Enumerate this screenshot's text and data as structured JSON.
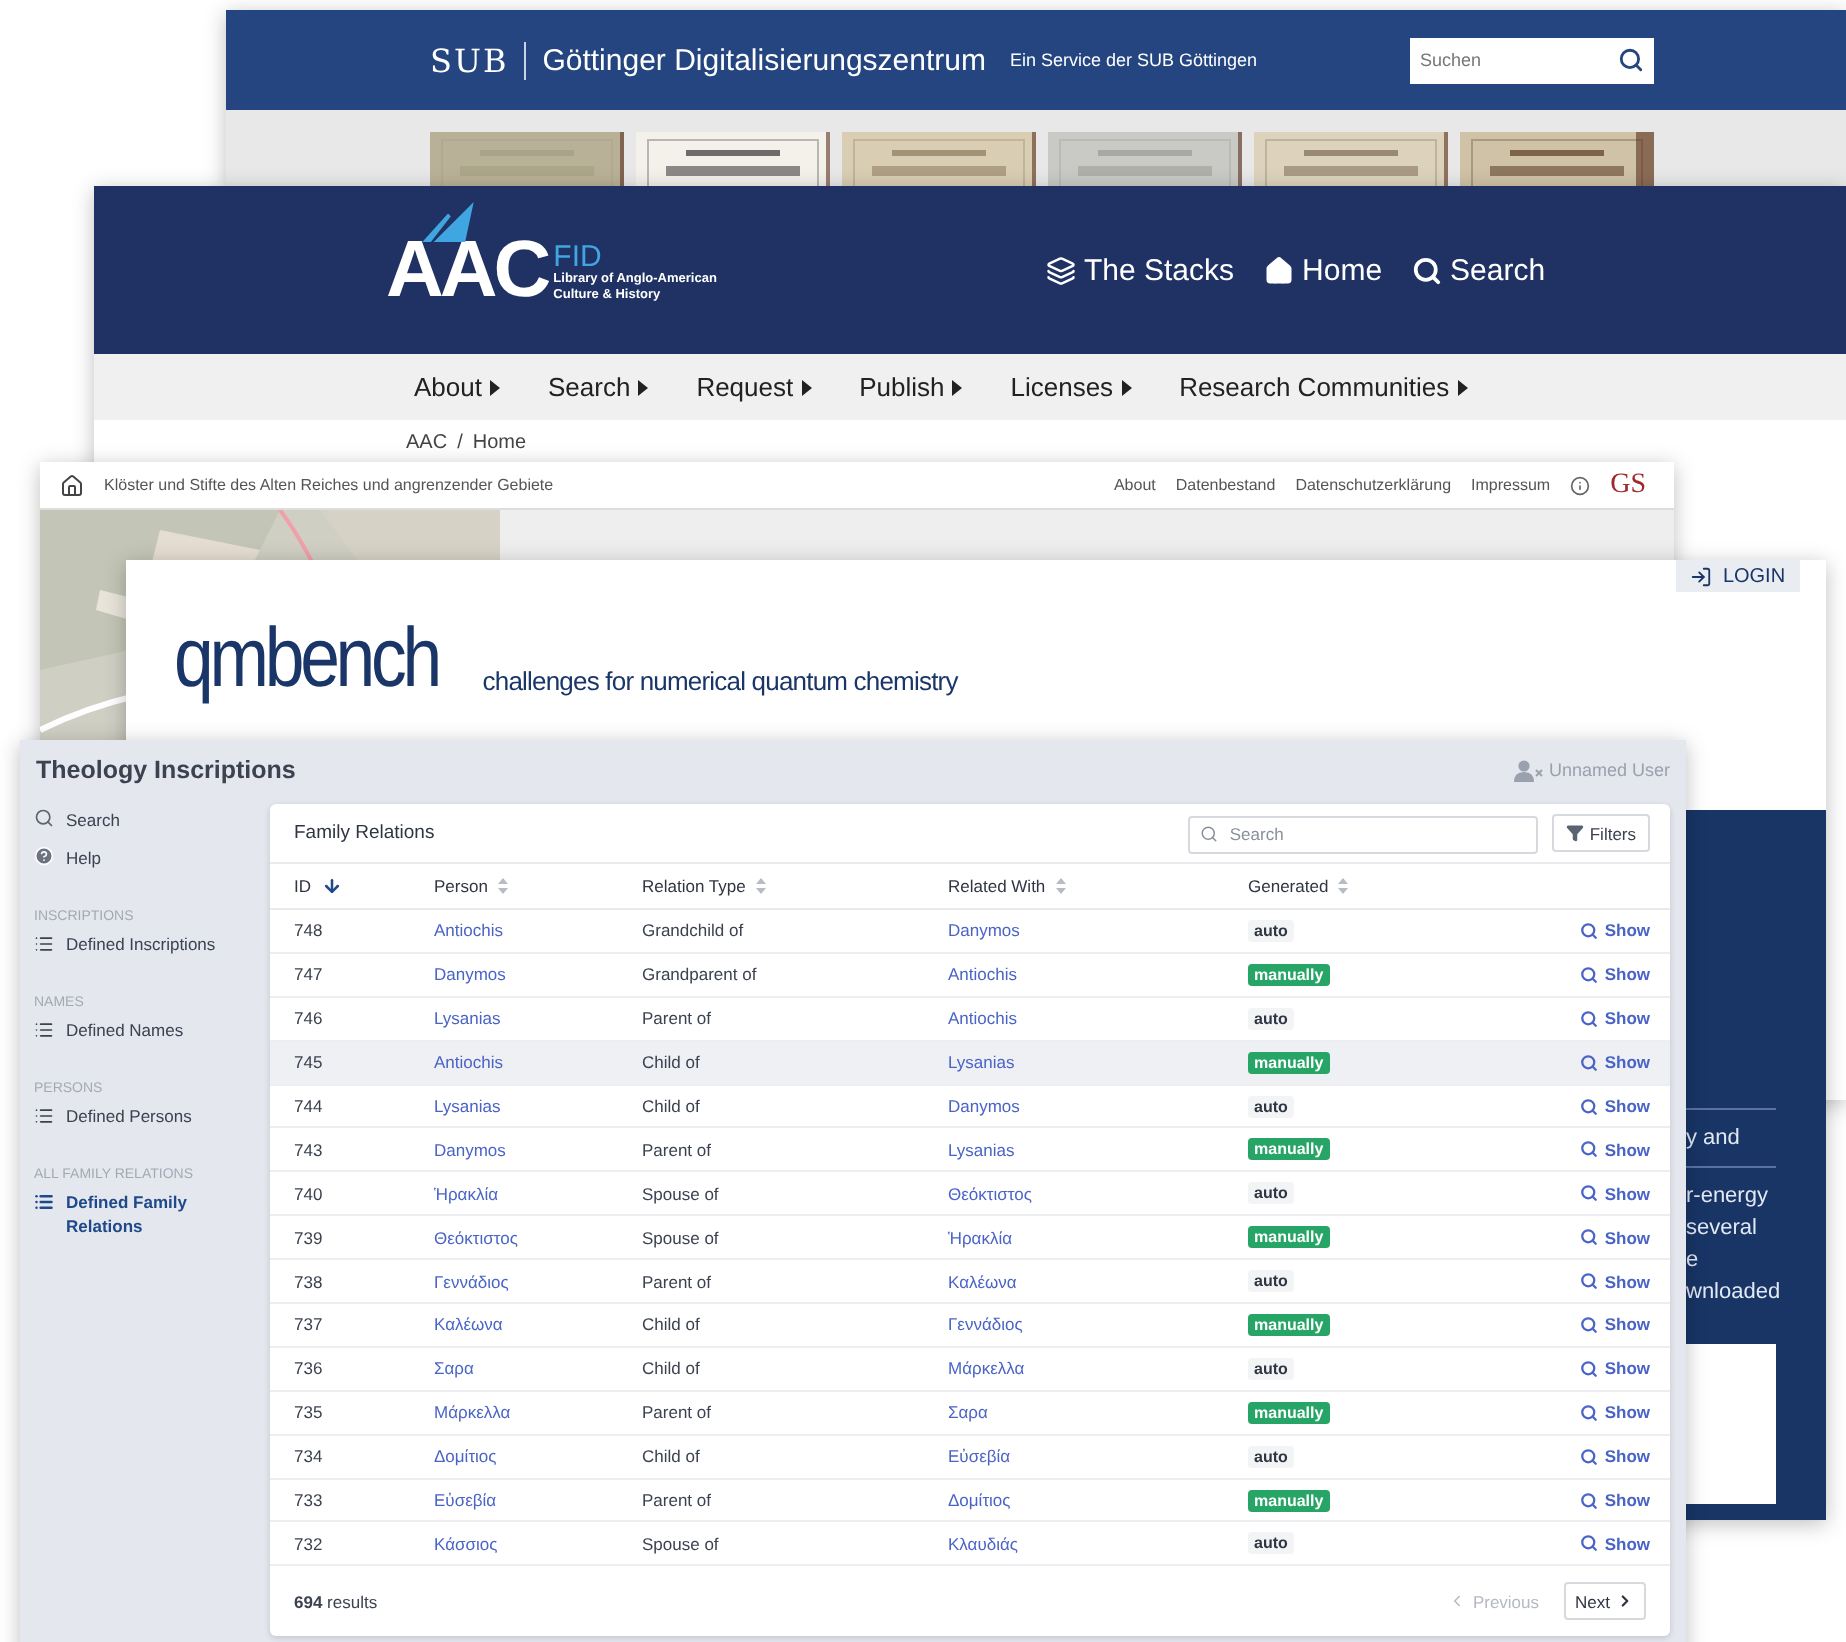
{
  "sub_window": {
    "logo": "SUB",
    "title": "Göttinger Digitalisierungszentrum",
    "subtitle": "Ein Service der SUB Göttingen",
    "search": {
      "placeholder": "Suchen"
    },
    "thumbnails": [
      {
        "kind": "picture"
      },
      {
        "kind": "picture"
      },
      {
        "kind": "picture"
      },
      {
        "kind": "picture"
      },
      {
        "kind": "picture"
      },
      {
        "kind": "picture"
      }
    ]
  },
  "aac_window": {
    "logo": {
      "mark": "AAC",
      "suffix": "FID",
      "tagline": [
        "Library of Anglo-American",
        "Culture & History"
      ]
    },
    "header_links": [
      {
        "label": "The Stacks",
        "kind": "stacks"
      },
      {
        "label": "Home",
        "kind": "home"
      },
      {
        "label": "Search",
        "kind": "search"
      }
    ],
    "nav": [
      "About",
      "Search",
      "Request",
      "Publish",
      "Licenses",
      "Research Communities"
    ],
    "breadcrumb": {
      "items": [
        "AAC",
        "Home"
      ],
      "separator": "/"
    }
  },
  "gs_window": {
    "title": "Klöster und Stifte des Alten Reiches und angrenzender Gebiete",
    "links": [
      "About",
      "Datenbestand",
      "Datenschutzerklärung",
      "Impressum"
    ],
    "logo": "GS",
    "map": {
      "kind": "picture"
    }
  },
  "qmbench_window": {
    "login": "LOGIN",
    "title": "qmbench",
    "tagline": "challenges for numerical quantum chemistry",
    "panel_blocks": [
      [
        "y and"
      ],
      [
        "r-energy",
        "several",
        "e",
        "wnloaded"
      ]
    ]
  },
  "inscriptions_window": {
    "title": "Theology Inscriptions",
    "user": "Unnamed User",
    "sidebar": {
      "top_items": [
        {
          "label": "Search",
          "kind": "search",
          "selected": false
        },
        {
          "label": "Help",
          "kind": "help",
          "selected": false
        }
      ],
      "sections": [
        {
          "heading": "INSCRIPTIONS",
          "items": [
            {
              "label": "Defined Inscriptions",
              "selected": false
            }
          ]
        },
        {
          "heading": "NAMES",
          "items": [
            {
              "label": "Defined Names",
              "selected": false
            }
          ]
        },
        {
          "heading": "PERSONS",
          "items": [
            {
              "label": "Defined Persons",
              "selected": false
            }
          ]
        },
        {
          "heading": "ALL FAMILY RELATIONS",
          "items": [
            {
              "label": "Defined Family Relations",
              "selected": true
            }
          ]
        }
      ]
    },
    "table": {
      "title": "Family Relations",
      "search": {
        "placeholder": "Search"
      },
      "filters_button": "Filters",
      "columns": [
        {
          "label": "ID",
          "sorted": true
        },
        {
          "label": "Person",
          "sorted": false
        },
        {
          "label": "Relation Type",
          "sorted": false
        },
        {
          "label": "Related With",
          "sorted": false
        },
        {
          "label": "Generated",
          "sorted": false
        }
      ],
      "rows": [
        {
          "id": "748",
          "person": "Antiochis",
          "relation": "Grandchild of",
          "related": "Danymos",
          "generated": "auto",
          "manual": false,
          "action": "Show",
          "highlighted": false
        },
        {
          "id": "747",
          "person": "Danymos",
          "relation": "Grandparent of",
          "related": "Antiochis",
          "generated": "manually",
          "manual": true,
          "action": "Show",
          "highlighted": false
        },
        {
          "id": "746",
          "person": "Lysanias",
          "relation": "Parent of",
          "related": "Antiochis",
          "generated": "auto",
          "manual": false,
          "action": "Show",
          "highlighted": false
        },
        {
          "id": "745",
          "person": "Antiochis",
          "relation": "Child of",
          "related": "Lysanias",
          "generated": "manually",
          "manual": true,
          "action": "Show",
          "highlighted": true
        },
        {
          "id": "744",
          "person": "Lysanias",
          "relation": "Child of",
          "related": "Danymos",
          "generated": "auto",
          "manual": false,
          "action": "Show",
          "highlighted": false
        },
        {
          "id": "743",
          "person": "Danymos",
          "relation": "Parent of",
          "related": "Lysanias",
          "generated": "manually",
          "manual": true,
          "action": "Show",
          "highlighted": false
        },
        {
          "id": "740",
          "person": "Ἡρακλία",
          "relation": "Spouse of",
          "related": "Θεόκτιστος",
          "generated": "auto",
          "manual": false,
          "action": "Show",
          "highlighted": false
        },
        {
          "id": "739",
          "person": "Θεόκτιστος",
          "relation": "Spouse of",
          "related": "Ἡρακλία",
          "generated": "manually",
          "manual": true,
          "action": "Show",
          "highlighted": false
        },
        {
          "id": "738",
          "person": "Γεννάδιος",
          "relation": "Parent of",
          "related": "Καλέωνα",
          "generated": "auto",
          "manual": false,
          "action": "Show",
          "highlighted": false
        },
        {
          "id": "737",
          "person": "Καλέωνα",
          "relation": "Child of",
          "related": "Γεννάδιος",
          "generated": "manually",
          "manual": true,
          "action": "Show",
          "highlighted": false
        },
        {
          "id": "736",
          "person": "Σαρα",
          "relation": "Child of",
          "related": "Μάρκελλα",
          "generated": "auto",
          "manual": false,
          "action": "Show",
          "highlighted": false
        },
        {
          "id": "735",
          "person": "Μάρκελλα",
          "relation": "Parent of",
          "related": "Σαρα",
          "generated": "manually",
          "manual": true,
          "action": "Show",
          "highlighted": false
        },
        {
          "id": "734",
          "person": "Δομίτιος",
          "relation": "Child of",
          "related": "Εὐσεβία",
          "generated": "auto",
          "manual": false,
          "action": "Show",
          "highlighted": false
        },
        {
          "id": "733",
          "person": "Εὐσεβία",
          "relation": "Parent of",
          "related": "Δομίτιος",
          "generated": "manually",
          "manual": true,
          "action": "Show",
          "highlighted": false
        },
        {
          "id": "732",
          "person": "Κάσσιος",
          "relation": "Spouse of",
          "related": "Κλαυδιάς",
          "generated": "auto",
          "manual": false,
          "action": "Show",
          "highlighted": false
        }
      ],
      "results": "**694** results",
      "pagination": {
        "previous": {
          "label": "Previous",
          "disabled": true
        },
        "next": {
          "label": "Next",
          "disabled": false
        }
      }
    }
  }
}
